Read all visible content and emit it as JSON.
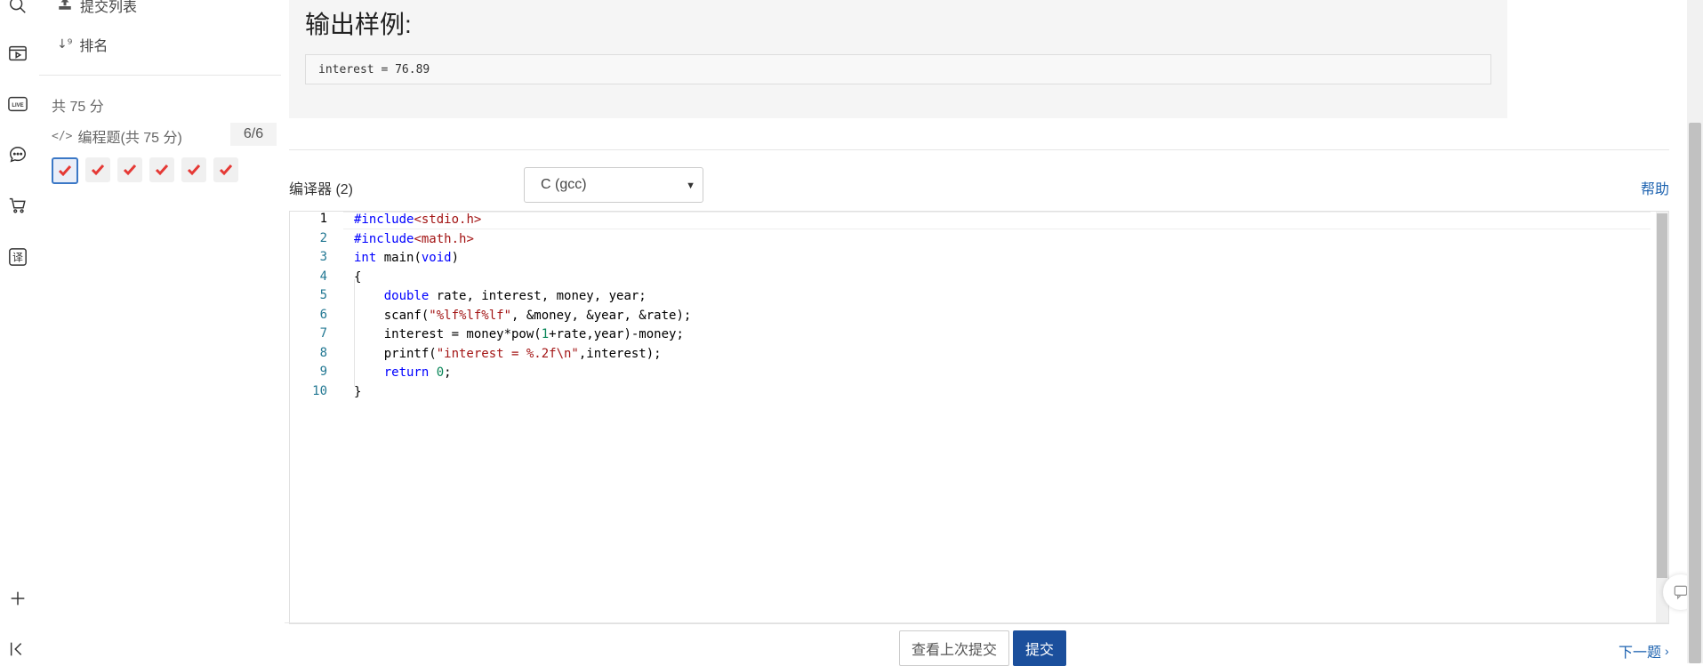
{
  "nav": {
    "submit_list": "提交列表",
    "rank": "排名"
  },
  "score": {
    "total": "共 75 分",
    "category": "编程题(共 75 分)",
    "count": "6/6"
  },
  "problems": [
    {
      "status": "accepted"
    },
    {
      "status": "accepted"
    },
    {
      "status": "accepted"
    },
    {
      "status": "accepted"
    },
    {
      "status": "accepted"
    },
    {
      "status": "accepted"
    }
  ],
  "sample": {
    "heading": "输出样例:",
    "output": "interest = 76.89"
  },
  "compiler": {
    "label": "编译器 (2)",
    "selected": "C (gcc)",
    "help": "帮助"
  },
  "editor": {
    "line_numbers": [
      "1",
      "2",
      "3",
      "4",
      "5",
      "6",
      "7",
      "8",
      "9",
      "10"
    ],
    "lines": [
      "#include<stdio.h>",
      "#include<math.h>",
      "int main(void)",
      "{",
      "    double rate, interest, money, year;",
      "    scanf(\"%lf%lf%lf\", &money, &year, &rate);",
      "    interest = money*pow(1+rate,year)-money;",
      "    printf(\"interest = %.2f\\n\",interest);",
      "    return 0;",
      "}"
    ]
  },
  "actions": {
    "view_last": "查看上次提交",
    "submit": "提交",
    "next": "下一题"
  },
  "colors": {
    "primary": "#1b4f9c",
    "link": "#1e63b0",
    "check": "#e53935"
  }
}
